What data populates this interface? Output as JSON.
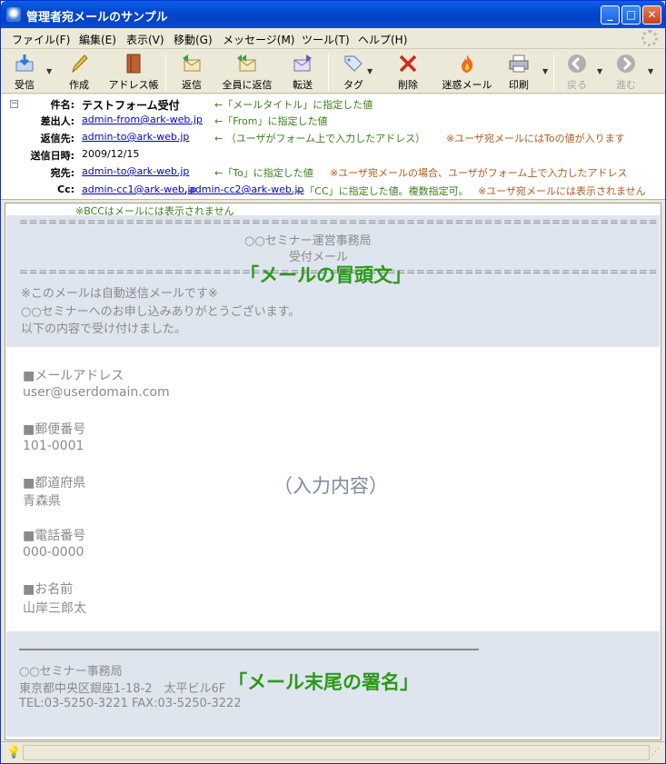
{
  "window": {
    "title": "管理者宛メールのサンプル"
  },
  "menu": [
    "ファイル(F)",
    "編集(E)",
    "表示(V)",
    "移動(G)",
    "メッセージ(M)",
    "ツール(T)",
    "ヘルプ(H)"
  ],
  "toolbar": {
    "receive": "受信",
    "compose": "作成",
    "addressbook": "アドレス帳",
    "reply": "返信",
    "reply_all": "全員に返信",
    "forward": "転送",
    "tag": "タグ",
    "delete": "削除",
    "junk": "迷惑メール",
    "print": "印刷",
    "back": "戻る",
    "next": "進む"
  },
  "headers": {
    "subject_label": "件名:",
    "subject": "テストフォーム受付",
    "from_label": "差出人:",
    "from": "admin-from@ark-web.jp",
    "replyto_label": "返信先:",
    "replyto": "admin-to@ark-web.jp",
    "date_label": "送信日時:",
    "date": "2009/12/15",
    "to_label": "宛先:",
    "to": "admin-to@ark-web.jp",
    "cc_label": "Cc:",
    "cc1": "admin-cc1@ark-web.jp",
    "cc_sep": ",",
    "cc2": "admin-cc2@ark-web.jp"
  },
  "notes": {
    "subject": "←「メールタイトル」に指定した値",
    "from": "←「From」に指定した値",
    "replyto_a": "← （ユーザがフォーム上で入力したアドレス）",
    "replyto_b": "※ユーザ宛メールにはToの値が入ります",
    "to_a": "←「To」に指定した値",
    "to_b": "※ユーザ宛メールの場合、ユーザがフォーム上で入力したアドレス",
    "cc_a": "←「CC」に指定した値。複数指定可。",
    "cc_b": "※ユーザ宛メールには表示されません",
    "bcc": "※BCCはメールには表示されません",
    "head_label": "「メールの冒頭文」",
    "input_label": "（入力内容）",
    "sig_label": "「メール末尾の署名」"
  },
  "body": {
    "rule_top": "==================================================================",
    "org": "○○セミナー運営事務局",
    "receipt": "受付メール",
    "rule_mid": "==================================================================",
    "auto1": "※このメールは自動送信メールです※",
    "auto2": "○○セミナーへのお申し込みありがとうございます。",
    "auto3": "以下の内容で受け付けました。",
    "fields": [
      {
        "label": "■メールアドレス",
        "value": "user@userdomain.com"
      },
      {
        "label": "■郵便番号",
        "value": "101-0001"
      },
      {
        "label": "■都道府県",
        "value": "青森県"
      },
      {
        "label": "■電話番号",
        "value": "000-0000"
      },
      {
        "label": "■お名前",
        "value": "山岸三郎太"
      }
    ],
    "sig_org": "○○セミナー事務局",
    "sig_addr": "東京都中央区銀座1-18-2　太平ビル6F",
    "sig_tel": "TEL:03-5250-3221 FAX:03-5250-3222"
  }
}
